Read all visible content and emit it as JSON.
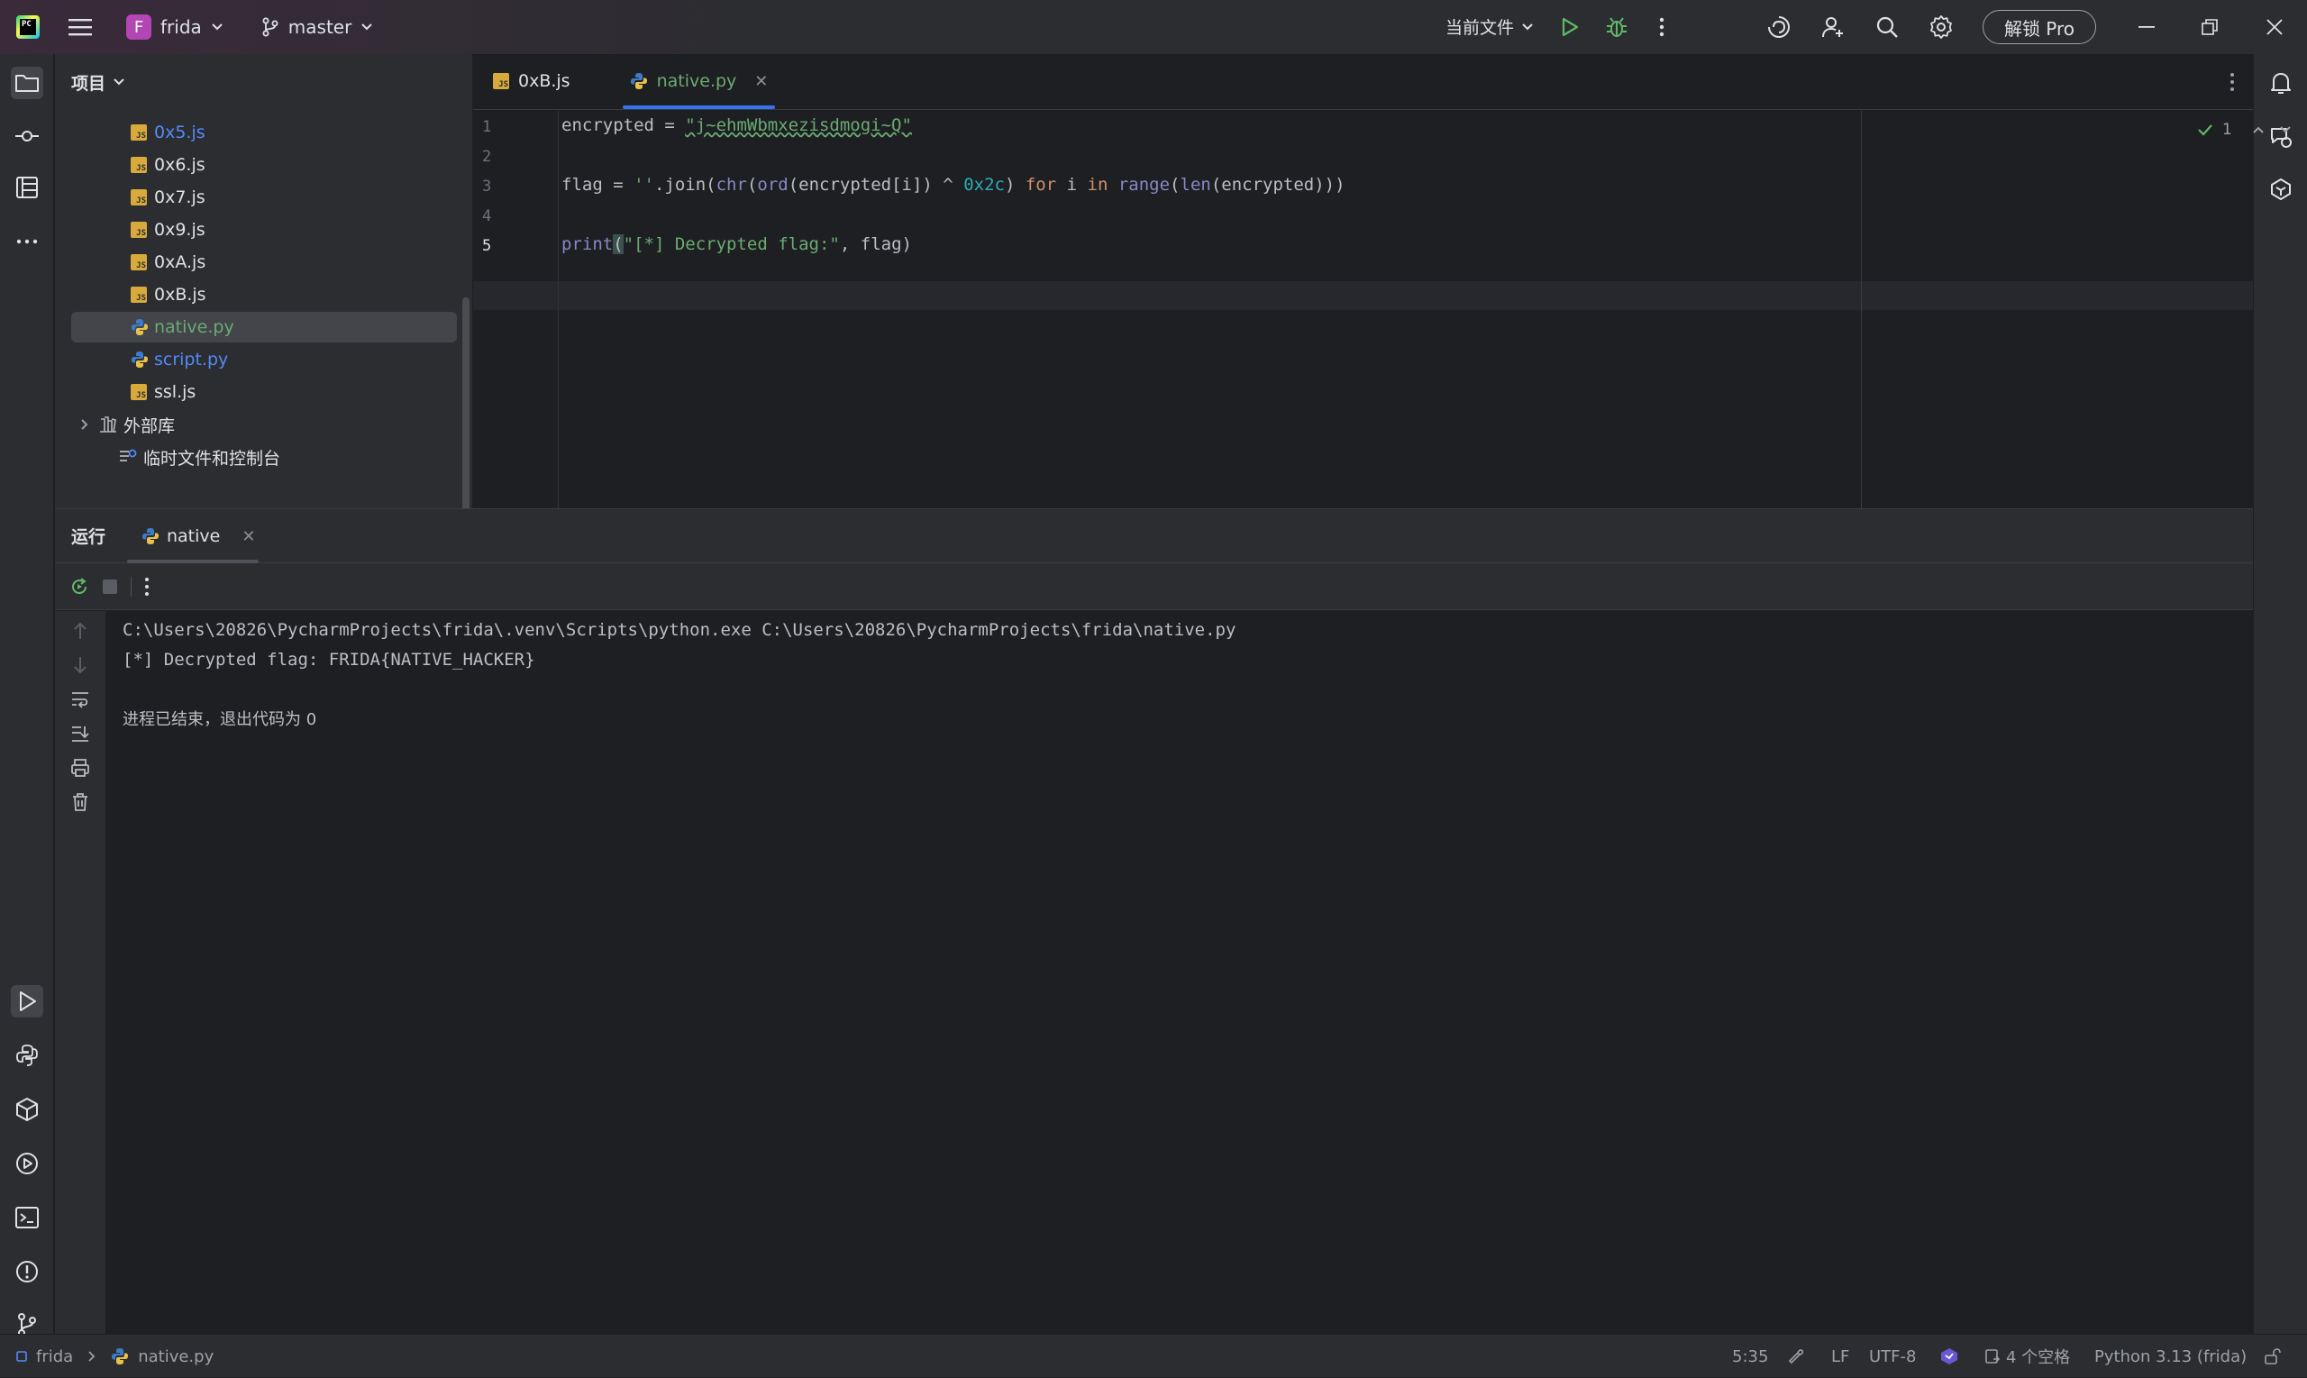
{
  "titlebar": {
    "project_initial": "F",
    "project_name": "frida",
    "branch": "master",
    "run_config": "当前文件",
    "unlock_label": "解锁 Pro"
  },
  "project_panel": {
    "title": "项目",
    "files": [
      {
        "name": "0x5.js",
        "type": "js",
        "color": "blue"
      },
      {
        "name": "0x6.js",
        "type": "js",
        "color": "default"
      },
      {
        "name": "0x7.js",
        "type": "js",
        "color": "default"
      },
      {
        "name": "0x9.js",
        "type": "js",
        "color": "default"
      },
      {
        "name": "0xA.js",
        "type": "js",
        "color": "default"
      },
      {
        "name": "0xB.js",
        "type": "js",
        "color": "default"
      },
      {
        "name": "native.py",
        "type": "py",
        "color": "green",
        "selected": true
      },
      {
        "name": "script.py",
        "type": "py",
        "color": "blue"
      },
      {
        "name": "ssl.js",
        "type": "js",
        "color": "default"
      }
    ],
    "external_libs": "外部库",
    "scratches": "临时文件和控制台"
  },
  "editor": {
    "tabs": [
      {
        "label": "0xB.js",
        "active": false
      },
      {
        "label": "native.py",
        "active": true
      }
    ],
    "line_numbers": [
      "1",
      "2",
      "3",
      "4",
      "5"
    ],
    "current_line": 5,
    "inspection_count": "1",
    "code": {
      "l1_var": "encrypted = ",
      "l1_str": "\"j~ehmWbmxezisdmogi~Q\"",
      "l3_a": "flag = ",
      "l3_b": "''",
      "l3_c": ".join(",
      "l3_d": "chr",
      "l3_e": "(",
      "l3_f": "ord",
      "l3_g": "(encrypted[i]) ^ ",
      "l3_h": "0x2c",
      "l3_i": ") ",
      "l3_j": "for",
      "l3_k": " i ",
      "l3_l": "in",
      "l3_m": " ",
      "l3_n": "range",
      "l3_o": "(",
      "l3_p": "len",
      "l3_q": "(encrypted)))",
      "l5_a": "print",
      "l5_b": "(",
      "l5_c": "\"[*] Decrypted flag:\"",
      "l5_d": ", flag)"
    }
  },
  "run_panel": {
    "title": "运行",
    "tab_label": "native",
    "output": [
      "C:\\Users\\20826\\PycharmProjects\\frida\\.venv\\Scripts\\python.exe C:\\Users\\20826\\PycharmProjects\\frida\\native.py",
      "[*] Decrypted flag: FRIDA{NATIVE_HACKER}",
      "",
      "进程已结束，退出代码为 0"
    ]
  },
  "statusbar": {
    "project": "frida",
    "file": "native.py",
    "position": "5:35",
    "line_sep": "LF",
    "encoding": "UTF-8",
    "indent": "4 个空格",
    "interpreter": "Python 3.13 (frida)"
  },
  "colors": {
    "accent": "#3574f0",
    "string": "#6aab73",
    "number": "#2aacb8",
    "keyword": "#cf8e6d",
    "builtin": "#8888c6",
    "project_badge": "#b346b5"
  }
}
